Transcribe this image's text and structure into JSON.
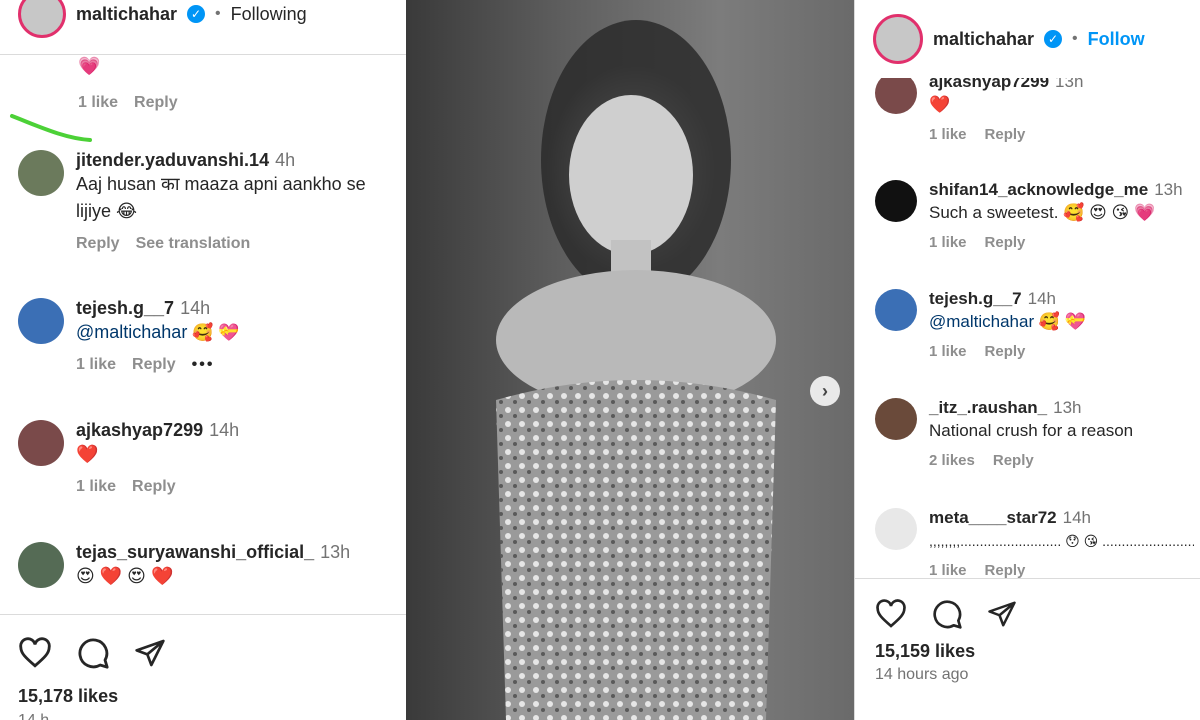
{
  "left": {
    "header": {
      "username": "maltichahar",
      "separator": "•",
      "status": "Following"
    },
    "top_reaction": {
      "emoji": "💗",
      "likes": "1 like",
      "reply": "Reply"
    },
    "comments": [
      {
        "user": "jitender.yaduvanshi.14",
        "time": "4h",
        "text_line1": "Aaj husan का maaza apni aankho se",
        "text_line2": "lijiye 😂",
        "reply": "Reply",
        "translate": "See translation"
      },
      {
        "user": "tejesh.g__7",
        "time": "14h",
        "mention": "@maltichahar",
        "emojis": "🥰 💝",
        "likes": "1 like",
        "reply": "Reply",
        "more": "•••"
      },
      {
        "user": "ajkashyap7299",
        "time": "14h",
        "emojis": "❤️",
        "likes": "1 like",
        "reply": "Reply"
      },
      {
        "user": "tejas_suryawanshi_official_",
        "time": "13h",
        "emojis": "😍 ❤️ 😍 ❤️",
        "reply": "Reply"
      }
    ],
    "likes_count": "15,178 likes",
    "cut_text": "14 h..."
  },
  "right": {
    "header": {
      "username": "maltichahar",
      "separator": "•",
      "follow": "Follow"
    },
    "comments": [
      {
        "user": "ajkashyap7299",
        "time": "13h",
        "text": "❤️",
        "likes": "1 like",
        "reply": "Reply"
      },
      {
        "user": "shifan14_acknowledge_me",
        "time": "13h",
        "text": "Such a sweetest. 🥰 😍 😘 💗",
        "likes": "1 like",
        "reply": "Reply"
      },
      {
        "user": "tejesh.g__7",
        "time": "14h",
        "mention": "@maltichahar",
        "emojis": "🥰 💝",
        "likes": "1 like",
        "reply": "Reply"
      },
      {
        "user": "_itz_.raushan_",
        "time": "13h",
        "text": "National crush for a reason",
        "likes": "2 likes",
        "reply": "Reply"
      },
      {
        "user": "meta____star72",
        "time": "14h",
        "text": ",,,,,,,,.......................... 😯 😘 ................................,,,",
        "likes": "1 like",
        "reply": "Reply"
      }
    ],
    "likes_count": "15,159 likes",
    "time_ago": "14 hours ago"
  },
  "photo": {
    "next_icon": "›"
  },
  "colors": {
    "accent": "#0095f6",
    "heart": "#ed4956",
    "annotation": "#4cd137"
  }
}
